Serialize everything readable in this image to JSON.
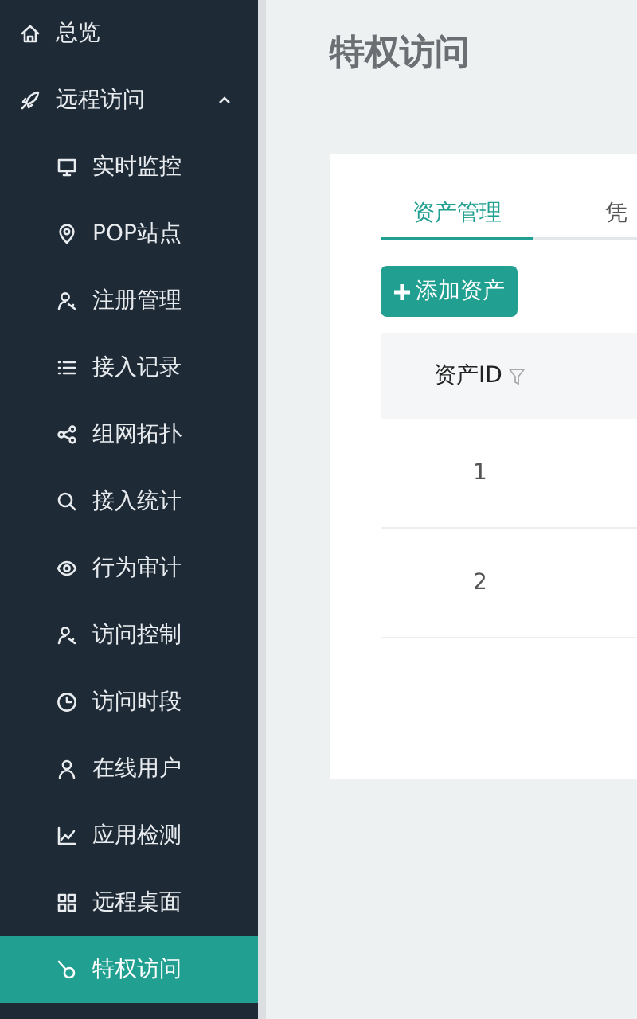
{
  "sidebar": {
    "items": [
      {
        "label": "总览",
        "selected": false
      },
      {
        "label": "远程访问",
        "expanded": true,
        "selected": false,
        "children": [
          {
            "label": "实时监控",
            "selected": false
          },
          {
            "label": "POP站点",
            "selected": false
          },
          {
            "label": "注册管理",
            "selected": false
          },
          {
            "label": "接入记录",
            "selected": false
          },
          {
            "label": "组网拓扑",
            "selected": false
          },
          {
            "label": "接入统计",
            "selected": false
          },
          {
            "label": "行为审计",
            "selected": false
          },
          {
            "label": "访问控制",
            "selected": false
          },
          {
            "label": "访问时段",
            "selected": false
          },
          {
            "label": "在线用户",
            "selected": false
          },
          {
            "label": "应用检测",
            "selected": false
          },
          {
            "label": "远程桌面",
            "selected": false
          },
          {
            "label": "特权访问",
            "selected": true
          }
        ]
      }
    ]
  },
  "page_title": "特权访问",
  "tabs": [
    {
      "label": "资产管理",
      "selected": true
    },
    {
      "label": "凭",
      "selected": false
    }
  ],
  "add_button": {
    "label": "添加资产"
  },
  "table": {
    "columns": [
      {
        "label": "资产ID"
      }
    ],
    "rows": [
      [
        "1"
      ],
      [
        "2"
      ]
    ]
  }
}
